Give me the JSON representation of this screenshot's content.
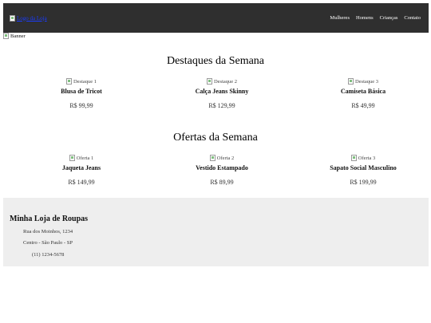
{
  "header": {
    "logo_alt": "Logo da Loja",
    "nav": [
      "Mulheres",
      "Homens",
      "Crianças",
      "Contato"
    ]
  },
  "banner_alt": "Banner",
  "featured": {
    "title": "Destaques da Semana",
    "items": [
      {
        "image_alt": "Destaque 1",
        "name": "Blusa de Tricot",
        "price": "R$ 99,99"
      },
      {
        "image_alt": "Destaque 2",
        "name": "Calça Jeans Skinny",
        "price": "R$ 129,99"
      },
      {
        "image_alt": "Destaque 3",
        "name": "Camiseta Básica",
        "price": "R$ 49,99"
      }
    ]
  },
  "offers": {
    "title": "Ofertas da Semana",
    "items": [
      {
        "image_alt": "Oferta 1",
        "name": "Jaqueta Jeans",
        "price": "R$ 149,99"
      },
      {
        "image_alt": "Oferta 2",
        "name": "Vestido Estampado",
        "price": "R$ 89,99"
      },
      {
        "image_alt": "Oferta 3",
        "name": "Sapato Social Masculino",
        "price": "R$ 199,99"
      }
    ]
  },
  "footer": {
    "store_name": "Minha Loja de Roupas",
    "address_line1": "Rua dos Moinhos, 1234",
    "address_line2": "Centro - São Paulo - SP",
    "phone": "(11) 1234-5678"
  },
  "colors": {
    "header_bg": "#2f2f2f",
    "footer_bg": "#eeeeee",
    "link": "#1a3cff"
  }
}
